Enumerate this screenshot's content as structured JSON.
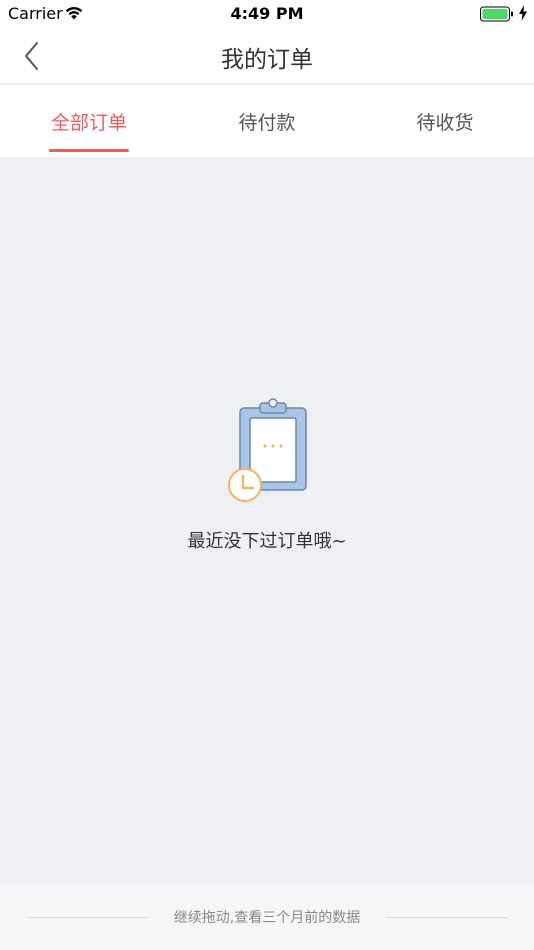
{
  "status_bar": {
    "carrier": "Carrier",
    "time": "4:49 PM",
    "battery_level": 1.0
  },
  "nav": {
    "title": "我的订单",
    "back_icon": "chevron-left-icon"
  },
  "tabs": [
    {
      "label": "全部订单",
      "active": true
    },
    {
      "label": "待付款",
      "active": false
    },
    {
      "label": "待收货",
      "active": false
    }
  ],
  "empty_state": {
    "icon": "clipboard-clock-icon",
    "message": "最近没下过订单哦~"
  },
  "footer": {
    "hint": "继续拖动,查看三个月前的数据"
  },
  "colors": {
    "accent": "#f25a5a",
    "background": "#eff0f4",
    "battery": "#4cd964",
    "illustration_blue": "#a8c4e6",
    "illustration_orange": "#f4b35c"
  }
}
